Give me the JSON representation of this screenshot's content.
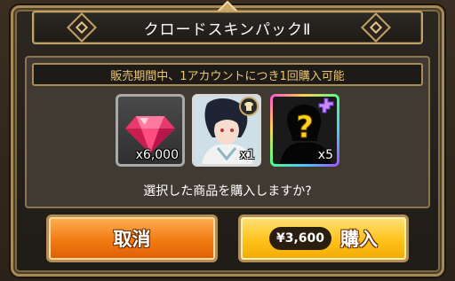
{
  "dialog": {
    "title": "クロードスキンパックⅡ",
    "notice": "販売期間中、1アカウントにつき1回購入可能",
    "items": [
      {
        "name": "gem",
        "quantity": "x6,000"
      },
      {
        "name": "character-skin",
        "quantity": "x1"
      },
      {
        "name": "mystery-item",
        "quantity": "x5"
      }
    ],
    "confirm_text": "選択した商品を購入しますか?",
    "cancel_label": "取消",
    "buy_label": "購入",
    "price": "¥3,600"
  },
  "icons": [
    "gem-icon",
    "character-portrait-icon",
    "shirt-badge-icon",
    "mystery-question-icon",
    "puzzle-piece-icon"
  ],
  "colors": {
    "notice_text": "#e9c877",
    "cancel_button": "#f27a12",
    "buy_button": "#ffc21a",
    "frame_gold": "#c2a266"
  }
}
